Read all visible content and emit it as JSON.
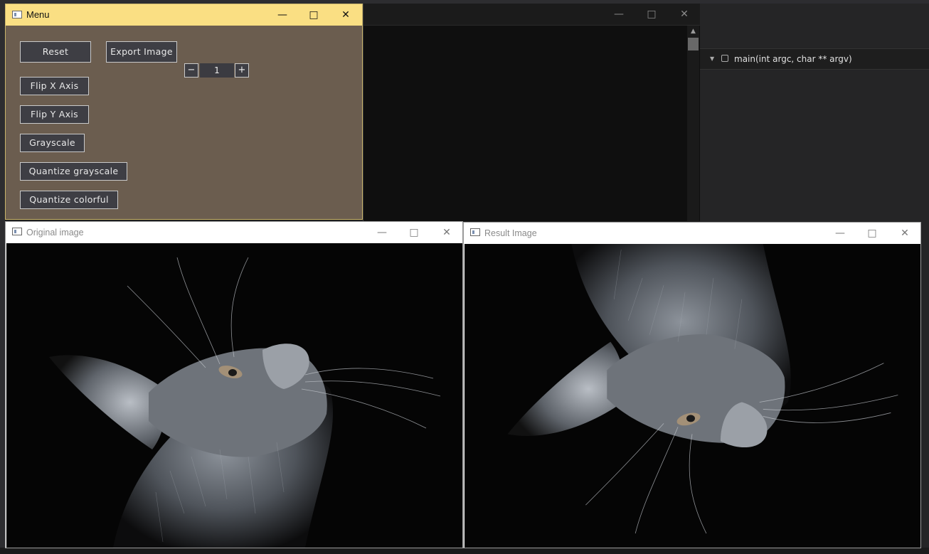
{
  "ide": {
    "nav_label": "main(int argc, char ** argv)",
    "editor_controls": [
      "—",
      "□",
      "✕"
    ]
  },
  "menu_window": {
    "title": "Menu",
    "controls": [
      "—",
      "□",
      "✕"
    ],
    "buttons": {
      "reset": "Reset",
      "export": "Export Image",
      "flip_x": "Flip X Axis",
      "flip_y": "Flip Y Axis",
      "grayscale": "Grayscale",
      "quantize_gray": "Quantize grayscale",
      "quantize_color": "Quantize colorful"
    },
    "stepper": {
      "minus": "−",
      "value": "1",
      "plus": "+"
    },
    "colors": {
      "background": "#6b5d4f",
      "titlebar": "#fadf83",
      "button": "#3e3e44"
    }
  },
  "original_window": {
    "title": "Original image",
    "controls": [
      "—",
      "□",
      "✕"
    ]
  },
  "result_window": {
    "title": "Result Image",
    "controls": [
      "—",
      "□",
      "✕"
    ]
  }
}
